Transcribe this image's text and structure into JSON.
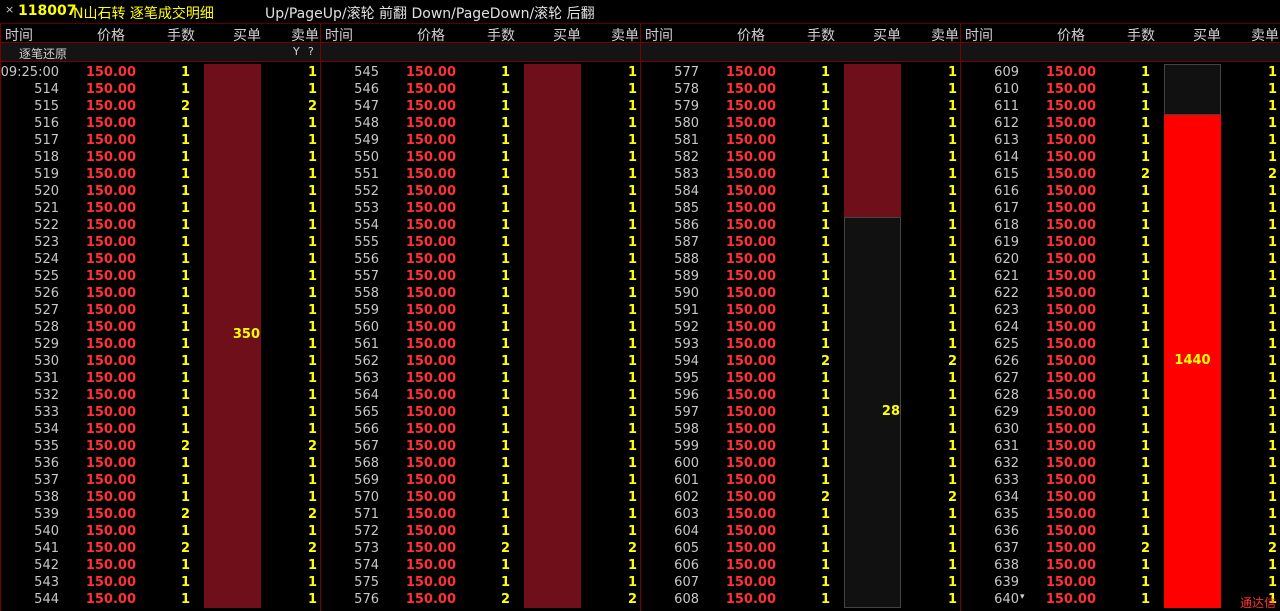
{
  "title": {
    "close": "×",
    "code": "118007",
    "name": "N山石转 逐笔成交明细",
    "hint": "Up/PageUp/滚轮 前翻 Down/PageDown/滚轮 后翻"
  },
  "columns": [
    "时间",
    "价格",
    "手数",
    "买单",
    "卖单"
  ],
  "toolbar": {
    "restore_label": "逐笔还原",
    "filter_icon": "filter-icon",
    "help_icon": "help-icon",
    "filter_glyph": "Y",
    "help_glyph": "?"
  },
  "colors": {
    "price": "#ff3232",
    "qty": "#ffff00",
    "time": "#c8c8c8",
    "bar_dark": "#6e0f1a",
    "bar_bright": "#ff0000",
    "border": "#7a0000"
  },
  "panels": [
    {
      "first_time": "09:25:00",
      "first_seq": 514,
      "price": "150.00",
      "rows": [
        {
          "t": "09:25:00",
          "p": "150.00",
          "q": "1",
          "s": "1"
        },
        {
          "t": "514",
          "p": "150.00",
          "q": "1",
          "s": "1"
        },
        {
          "t": "515",
          "p": "150.00",
          "q": "2",
          "s": "2"
        },
        {
          "t": "516",
          "p": "150.00",
          "q": "1",
          "s": "1"
        },
        {
          "t": "517",
          "p": "150.00",
          "q": "1",
          "s": "1"
        },
        {
          "t": "518",
          "p": "150.00",
          "q": "1",
          "s": "1"
        },
        {
          "t": "519",
          "p": "150.00",
          "q": "1",
          "s": "1"
        },
        {
          "t": "520",
          "p": "150.00",
          "q": "1",
          "s": "1"
        },
        {
          "t": "521",
          "p": "150.00",
          "q": "1",
          "s": "1"
        },
        {
          "t": "522",
          "p": "150.00",
          "q": "1",
          "s": "1"
        },
        {
          "t": "523",
          "p": "150.00",
          "q": "1",
          "s": "1"
        },
        {
          "t": "524",
          "p": "150.00",
          "q": "1",
          "s": "1"
        },
        {
          "t": "525",
          "p": "150.00",
          "q": "1",
          "s": "1"
        },
        {
          "t": "526",
          "p": "150.00",
          "q": "1",
          "s": "1"
        },
        {
          "t": "527",
          "p": "150.00",
          "q": "1",
          "s": "1"
        },
        {
          "t": "528",
          "p": "150.00",
          "q": "1",
          "s": "1"
        },
        {
          "t": "529",
          "p": "150.00",
          "q": "1",
          "s": "1"
        },
        {
          "t": "530",
          "p": "150.00",
          "q": "1",
          "s": "1"
        },
        {
          "t": "531",
          "p": "150.00",
          "q": "1",
          "s": "1"
        },
        {
          "t": "532",
          "p": "150.00",
          "q": "1",
          "s": "1"
        },
        {
          "t": "533",
          "p": "150.00",
          "q": "1",
          "s": "1"
        },
        {
          "t": "534",
          "p": "150.00",
          "q": "1",
          "s": "1"
        },
        {
          "t": "535",
          "p": "150.00",
          "q": "2",
          "s": "2"
        },
        {
          "t": "536",
          "p": "150.00",
          "q": "1",
          "s": "1"
        },
        {
          "t": "537",
          "p": "150.00",
          "q": "1",
          "s": "1"
        },
        {
          "t": "538",
          "p": "150.00",
          "q": "1",
          "s": "1"
        },
        {
          "t": "539",
          "p": "150.00",
          "q": "2",
          "s": "2"
        },
        {
          "t": "540",
          "p": "150.00",
          "q": "1",
          "s": "1"
        },
        {
          "t": "541",
          "p": "150.00",
          "q": "2",
          "s": "2"
        },
        {
          "t": "542",
          "p": "150.00",
          "q": "1",
          "s": "1"
        },
        {
          "t": "543",
          "p": "150.00",
          "q": "1",
          "s": "1"
        },
        {
          "t": "544",
          "p": "150.00",
          "q": "1",
          "s": "1"
        }
      ],
      "buy_blocks": [
        {
          "from": 0,
          "to": 31,
          "label": "350",
          "color": "dark"
        }
      ]
    },
    {
      "rows": [
        {
          "t": "545",
          "p": "150.00",
          "q": "1",
          "s": "1"
        },
        {
          "t": "546",
          "p": "150.00",
          "q": "1",
          "s": "1"
        },
        {
          "t": "547",
          "p": "150.00",
          "q": "1",
          "s": "1"
        },
        {
          "t": "548",
          "p": "150.00",
          "q": "1",
          "s": "1"
        },
        {
          "t": "549",
          "p": "150.00",
          "q": "1",
          "s": "1"
        },
        {
          "t": "550",
          "p": "150.00",
          "q": "1",
          "s": "1"
        },
        {
          "t": "551",
          "p": "150.00",
          "q": "1",
          "s": "1"
        },
        {
          "t": "552",
          "p": "150.00",
          "q": "1",
          "s": "1"
        },
        {
          "t": "553",
          "p": "150.00",
          "q": "1",
          "s": "1"
        },
        {
          "t": "554",
          "p": "150.00",
          "q": "1",
          "s": "1"
        },
        {
          "t": "555",
          "p": "150.00",
          "q": "1",
          "s": "1"
        },
        {
          "t": "556",
          "p": "150.00",
          "q": "1",
          "s": "1"
        },
        {
          "t": "557",
          "p": "150.00",
          "q": "1",
          "s": "1"
        },
        {
          "t": "558",
          "p": "150.00",
          "q": "1",
          "s": "1"
        },
        {
          "t": "559",
          "p": "150.00",
          "q": "1",
          "s": "1"
        },
        {
          "t": "560",
          "p": "150.00",
          "q": "1",
          "s": "1"
        },
        {
          "t": "561",
          "p": "150.00",
          "q": "1",
          "s": "1"
        },
        {
          "t": "562",
          "p": "150.00",
          "q": "1",
          "s": "1"
        },
        {
          "t": "563",
          "p": "150.00",
          "q": "1",
          "s": "1"
        },
        {
          "t": "564",
          "p": "150.00",
          "q": "1",
          "s": "1"
        },
        {
          "t": "565",
          "p": "150.00",
          "q": "1",
          "s": "1"
        },
        {
          "t": "566",
          "p": "150.00",
          "q": "1",
          "s": "1"
        },
        {
          "t": "567",
          "p": "150.00",
          "q": "1",
          "s": "1"
        },
        {
          "t": "568",
          "p": "150.00",
          "q": "1",
          "s": "1"
        },
        {
          "t": "569",
          "p": "150.00",
          "q": "1",
          "s": "1"
        },
        {
          "t": "570",
          "p": "150.00",
          "q": "1",
          "s": "1"
        },
        {
          "t": "571",
          "p": "150.00",
          "q": "1",
          "s": "1"
        },
        {
          "t": "572",
          "p": "150.00",
          "q": "1",
          "s": "1"
        },
        {
          "t": "573",
          "p": "150.00",
          "q": "2",
          "s": "2"
        },
        {
          "t": "574",
          "p": "150.00",
          "q": "1",
          "s": "1"
        },
        {
          "t": "575",
          "p": "150.00",
          "q": "1",
          "s": "1"
        },
        {
          "t": "576",
          "p": "150.00",
          "q": "2",
          "s": "2"
        }
      ],
      "buy_blocks": [
        {
          "from": 0,
          "to": 31,
          "label": "",
          "color": "dark"
        }
      ]
    },
    {
      "rows": [
        {
          "t": "577",
          "p": "150.00",
          "q": "1",
          "s": "1"
        },
        {
          "t": "578",
          "p": "150.00",
          "q": "1",
          "s": "1"
        },
        {
          "t": "579",
          "p": "150.00",
          "q": "1",
          "s": "1"
        },
        {
          "t": "580",
          "p": "150.00",
          "q": "1",
          "s": "1"
        },
        {
          "t": "581",
          "p": "150.00",
          "q": "1",
          "s": "1"
        },
        {
          "t": "582",
          "p": "150.00",
          "q": "1",
          "s": "1"
        },
        {
          "t": "583",
          "p": "150.00",
          "q": "1",
          "s": "1"
        },
        {
          "t": "584",
          "p": "150.00",
          "q": "1",
          "s": "1"
        },
        {
          "t": "585",
          "p": "150.00",
          "q": "1",
          "s": "1"
        },
        {
          "t": "586",
          "p": "150.00",
          "q": "1",
          "s": "1"
        },
        {
          "t": "587",
          "p": "150.00",
          "q": "1",
          "s": "1"
        },
        {
          "t": "588",
          "p": "150.00",
          "q": "1",
          "s": "1"
        },
        {
          "t": "589",
          "p": "150.00",
          "q": "1",
          "s": "1"
        },
        {
          "t": "590",
          "p": "150.00",
          "q": "1",
          "s": "1"
        },
        {
          "t": "591",
          "p": "150.00",
          "q": "1",
          "s": "1"
        },
        {
          "t": "592",
          "p": "150.00",
          "q": "1",
          "s": "1"
        },
        {
          "t": "593",
          "p": "150.00",
          "q": "1",
          "s": "1"
        },
        {
          "t": "594",
          "p": "150.00",
          "q": "2",
          "s": "2"
        },
        {
          "t": "595",
          "p": "150.00",
          "q": "1",
          "s": "1"
        },
        {
          "t": "596",
          "p": "150.00",
          "q": "1",
          "s": "1"
        },
        {
          "t": "597",
          "p": "150.00",
          "q": "1",
          "s": "1"
        },
        {
          "t": "598",
          "p": "150.00",
          "q": "1",
          "s": "1"
        },
        {
          "t": "599",
          "p": "150.00",
          "q": "1",
          "s": "1"
        },
        {
          "t": "600",
          "p": "150.00",
          "q": "1",
          "s": "1"
        },
        {
          "t": "601",
          "p": "150.00",
          "q": "1",
          "s": "1"
        },
        {
          "t": "602",
          "p": "150.00",
          "q": "2",
          "s": "2"
        },
        {
          "t": "603",
          "p": "150.00",
          "q": "1",
          "s": "1"
        },
        {
          "t": "604",
          "p": "150.00",
          "q": "1",
          "s": "1"
        },
        {
          "t": "605",
          "p": "150.00",
          "q": "1",
          "s": "1"
        },
        {
          "t": "606",
          "p": "150.00",
          "q": "1",
          "s": "1"
        },
        {
          "t": "607",
          "p": "150.00",
          "q": "1",
          "s": "1"
        },
        {
          "t": "608",
          "p": "150.00",
          "q": "1",
          "s": "1"
        }
      ],
      "buy_blocks": [
        {
          "from": 0,
          "to": 8,
          "label": "",
          "color": "dark"
        },
        {
          "from": 9,
          "to": 31,
          "label": "28",
          "color": "empty"
        }
      ]
    },
    {
      "rows": [
        {
          "t": "609",
          "p": "150.00",
          "q": "1",
          "s": "1"
        },
        {
          "t": "610",
          "p": "150.00",
          "q": "1",
          "s": "1"
        },
        {
          "t": "611",
          "p": "150.00",
          "q": "1",
          "s": "1"
        },
        {
          "t": "612",
          "p": "150.00",
          "q": "1",
          "s": "1"
        },
        {
          "t": "613",
          "p": "150.00",
          "q": "1",
          "s": "1"
        },
        {
          "t": "614",
          "p": "150.00",
          "q": "1",
          "s": "1"
        },
        {
          "t": "615",
          "p": "150.00",
          "q": "2",
          "s": "2"
        },
        {
          "t": "616",
          "p": "150.00",
          "q": "1",
          "s": "1"
        },
        {
          "t": "617",
          "p": "150.00",
          "q": "1",
          "s": "1"
        },
        {
          "t": "618",
          "p": "150.00",
          "q": "1",
          "s": "1"
        },
        {
          "t": "619",
          "p": "150.00",
          "q": "1",
          "s": "1"
        },
        {
          "t": "620",
          "p": "150.00",
          "q": "1",
          "s": "1"
        },
        {
          "t": "621",
          "p": "150.00",
          "q": "1",
          "s": "1"
        },
        {
          "t": "622",
          "p": "150.00",
          "q": "1",
          "s": "1"
        },
        {
          "t": "623",
          "p": "150.00",
          "q": "1",
          "s": "1"
        },
        {
          "t": "624",
          "p": "150.00",
          "q": "1",
          "s": "1"
        },
        {
          "t": "625",
          "p": "150.00",
          "q": "1",
          "s": "1"
        },
        {
          "t": "626",
          "p": "150.00",
          "q": "1",
          "s": "1"
        },
        {
          "t": "627",
          "p": "150.00",
          "q": "1",
          "s": "1"
        },
        {
          "t": "628",
          "p": "150.00",
          "q": "1",
          "s": "1"
        },
        {
          "t": "629",
          "p": "150.00",
          "q": "1",
          "s": "1"
        },
        {
          "t": "630",
          "p": "150.00",
          "q": "1",
          "s": "1"
        },
        {
          "t": "631",
          "p": "150.00",
          "q": "1",
          "s": "1"
        },
        {
          "t": "632",
          "p": "150.00",
          "q": "1",
          "s": "1"
        },
        {
          "t": "633",
          "p": "150.00",
          "q": "1",
          "s": "1"
        },
        {
          "t": "634",
          "p": "150.00",
          "q": "1",
          "s": "1"
        },
        {
          "t": "635",
          "p": "150.00",
          "q": "1",
          "s": "1"
        },
        {
          "t": "636",
          "p": "150.00",
          "q": "1",
          "s": "1"
        },
        {
          "t": "637",
          "p": "150.00",
          "q": "2",
          "s": "2"
        },
        {
          "t": "638",
          "p": "150.00",
          "q": "1",
          "s": "1"
        },
        {
          "t": "639",
          "p": "150.00",
          "q": "1",
          "s": "1"
        },
        {
          "t": "640",
          "p": "150.00",
          "q": "1",
          "s": "1"
        }
      ],
      "buy_blocks": [
        {
          "from": 0,
          "to": 2,
          "label": "",
          "color": "empty"
        },
        {
          "from": 3,
          "to": 31,
          "label": "1440",
          "color": "bright"
        }
      ],
      "last_row_arrow": "▾"
    }
  ],
  "footer": {
    "brand": "通达信"
  }
}
